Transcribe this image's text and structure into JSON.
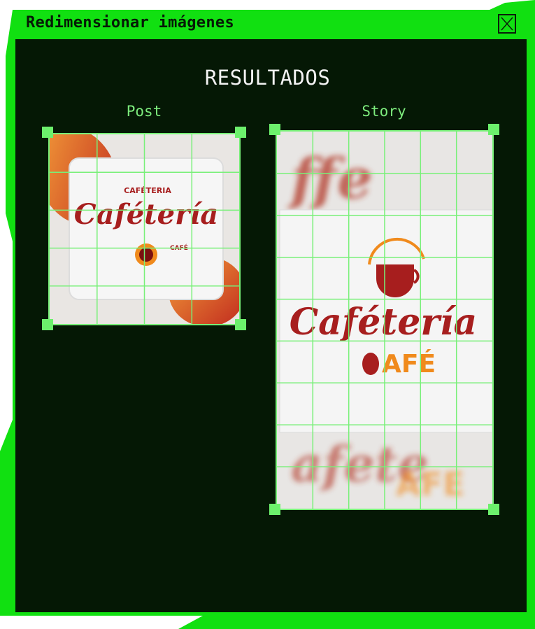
{
  "window": {
    "title": "Redimensionar imágenes",
    "close_icon": "close-icon"
  },
  "colors": {
    "frame_green": "#11e011",
    "panel_bg": "#051805",
    "grid_line": "#78f078",
    "label_green": "#7dec7d",
    "logo_red": "#a71e1e",
    "logo_orange": "#f08a1c"
  },
  "results": {
    "heading": "RESULTADOS",
    "post": {
      "label": "Post",
      "logo_top": "CAFÉTERIA",
      "logo_main": "Cafétería",
      "logo_sub": "CAFÉ"
    },
    "story": {
      "label": "Story",
      "logo_main": "Cafétería",
      "logo_sub": "AFÉ"
    }
  }
}
